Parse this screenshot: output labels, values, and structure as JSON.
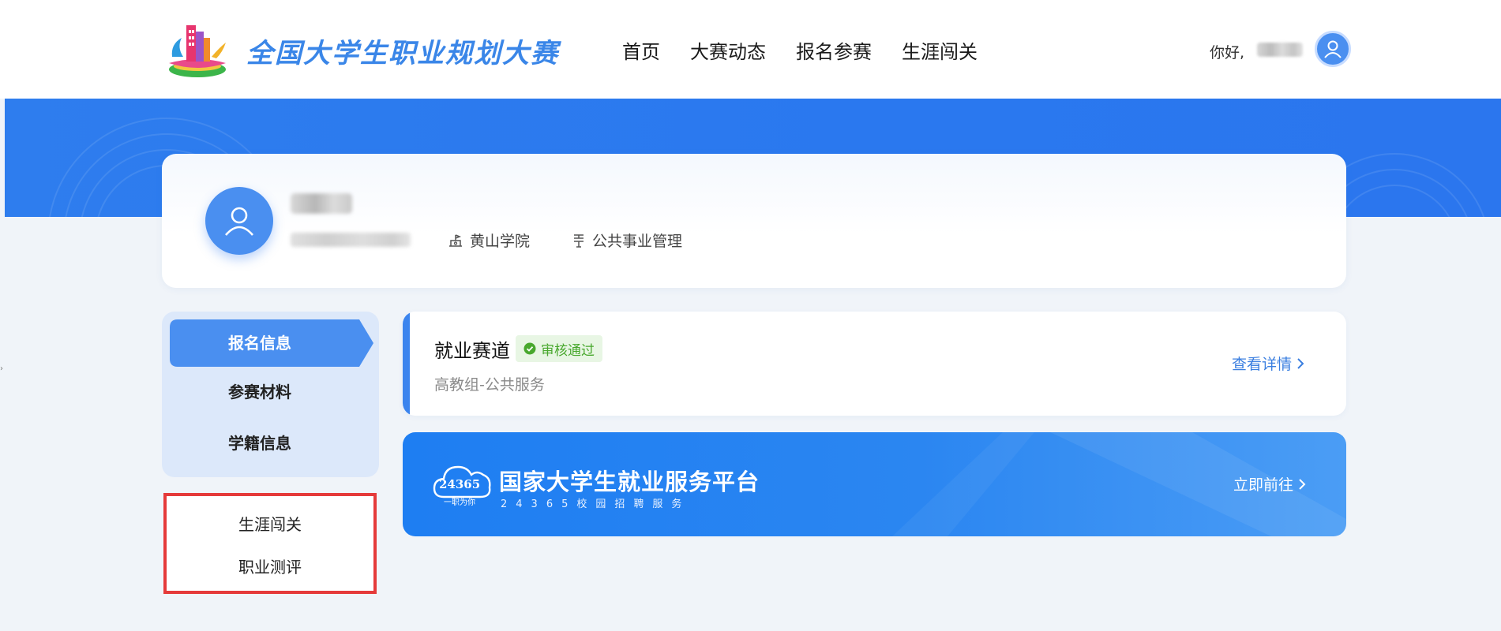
{
  "header": {
    "logo_title": "全国大学生职业规划大赛",
    "nav": [
      "首页",
      "大赛动态",
      "报名参赛",
      "生涯闯关"
    ],
    "greeting": "你好,"
  },
  "profile": {
    "school": "黄山学院",
    "major": "公共事业管理"
  },
  "side_menu": {
    "items": [
      "报名信息",
      "参赛材料",
      "学籍信息"
    ],
    "active_index": 0,
    "extra_items": [
      "生涯闯关",
      "职业测评"
    ]
  },
  "track": {
    "title": "就业赛道",
    "status": "审核通过",
    "subtitle": "高教组-公共服务",
    "link": "查看详情"
  },
  "platform": {
    "logo_number": "24365",
    "logo_tag": "一职为你",
    "title": "国家大学生就业服务平台",
    "subtitle": "24365校园招聘服务",
    "link": "立即前往"
  },
  "colors": {
    "primary": "#3b84ee",
    "banner": "#2a78ef",
    "success": "#48a82d",
    "highlight_border": "#e53a3a"
  }
}
